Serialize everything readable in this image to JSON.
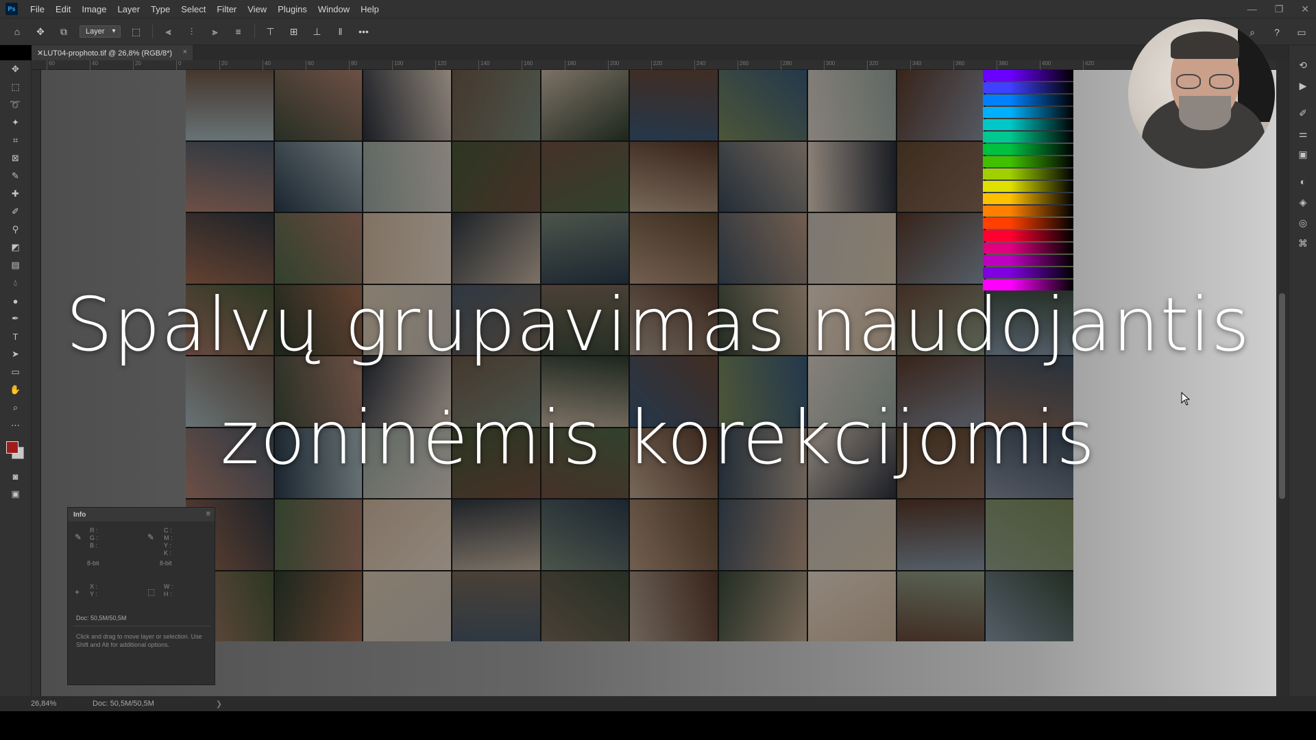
{
  "menubar": {
    "logo": "Ps",
    "items": [
      "File",
      "Edit",
      "Image",
      "Layer",
      "Type",
      "Select",
      "Filter",
      "View",
      "Plugins",
      "Window",
      "Help"
    ],
    "window_controls": [
      "—",
      "❐",
      "✕"
    ]
  },
  "options_bar": {
    "auto_select_value": "Layer",
    "more": "•••"
  },
  "document": {
    "tab_title": "✕LUT04-prophoto.tif @ 26,8% (RGB/8*)",
    "tab_close": "×"
  },
  "rulers": {
    "top_ticks": [
      "60",
      "40",
      "20",
      "0",
      "20",
      "40",
      "60",
      "80",
      "100",
      "120",
      "140",
      "160",
      "180",
      "200",
      "220",
      "240",
      "260",
      "280",
      "300",
      "320",
      "340",
      "360",
      "380",
      "400",
      "420"
    ]
  },
  "overlay": {
    "line1": "Spalvų grupavimas naudojantis",
    "line2": "zoninėmis korekcijomis"
  },
  "info_panel": {
    "title": "Info",
    "rgb_labels": "R :\nG :\nB :",
    "cmyk_labels": "C :\nM :\nY :\nK :",
    "bit_left": "8-bit",
    "bit_right": "8-bit",
    "xy_labels": "X :\nY :",
    "wh_labels": "W :\nH :",
    "doc_size": "Doc: 50,5M/50,5M",
    "hint": "Click and drag to move layer or selection. Use Shift and Alt for additional options."
  },
  "status_bar": {
    "zoom": "26,84%",
    "doc_size": "Doc: 50,5M/50,5M",
    "arrow": "❯"
  },
  "colors": {
    "foreground": "#a01c1c",
    "background": "#c8c8c8",
    "ui_dark": "#323232"
  },
  "collage_palette": [
    "#a7b8bd",
    "#3f4b3a",
    "#2a2f3a",
    "#6f5a4a",
    "#c9b7a4",
    "#3a5a7a",
    "#7b8a5a",
    "#d8cfc4",
    "#5a3a2a",
    "#8a6a5a",
    "#b08070",
    "#2c3c4c",
    "#9aa7a0",
    "#485838",
    "#705040",
    "#c0a890",
    "#384858",
    "#e0d0c0",
    "#604830",
    "#8890a0",
    "#a06a50",
    "#506848",
    "#d0b8a0",
    "#303840",
    "#7a8878",
    "#b89880",
    "#405060",
    "#c8c0b8",
    "#583828",
    "#90a088",
    "#a87868",
    "#2e3e2e",
    "#d8c8b0",
    "#4a5a6a",
    "#786858",
    "#b0a090",
    "#384838",
    "#e8d8c8",
    "#684838",
    "#8898a8"
  ],
  "rainbow_colors": [
    "#6b00ff",
    "#4040ff",
    "#0080ff",
    "#00b0ff",
    "#00c8c8",
    "#00c890",
    "#00c040",
    "#40c000",
    "#a0d000",
    "#e0e000",
    "#ffc000",
    "#ff8000",
    "#ff4000",
    "#ff0030",
    "#e00080",
    "#c000c0",
    "#8000e0",
    "#ff00ff"
  ]
}
